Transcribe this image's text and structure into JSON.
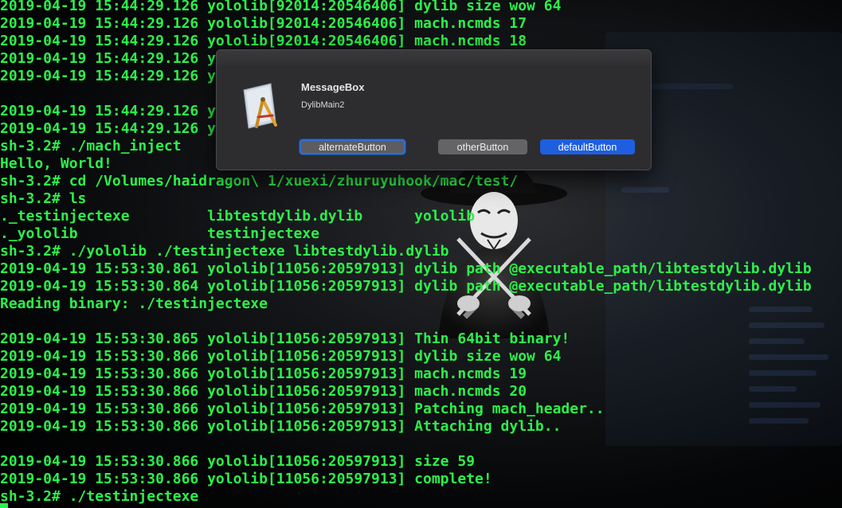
{
  "terminal": {
    "lines": [
      "2019-04-19 15:44:29.126 yololib[92014:20546406] dylib size wow 64",
      "2019-04-19 15:44:29.126 yololib[92014:20546406] mach.ncmds 17",
      "2019-04-19 15:44:29.126 yololib[92014:20546406] mach.ncmds 18",
      "2019-04-19 15:44:29.126 y",
      "2019-04-19 15:44:29.126 y",
      "",
      "2019-04-19 15:44:29.126 y",
      "2019-04-19 15:44:29.126 y",
      "sh-3.2# ./mach_inject",
      "Hello, World!",
      "sh-3.2# cd /Volumes/haidragon\\ 1/xuexi/zhuruyuhook/mac/test/",
      "sh-3.2# ls",
      "._testinjectexe         libtestdylib.dylib      yololib",
      "._yololib               testinjectexe",
      "sh-3.2# ./yololib ./testinjectexe libtestdylib.dylib",
      "2019-04-19 15:53:30.861 yololib[11056:20597913] dylib path @executable_path/libtestdylib.dylib",
      "2019-04-19 15:53:30.864 yololib[11056:20597913] dylib path @executable_path/libtestdylib.dylib",
      "Reading binary: ./testinjectexe",
      "",
      "2019-04-19 15:53:30.865 yololib[11056:20597913] Thin 64bit binary!",
      "2019-04-19 15:53:30.866 yololib[11056:20597913] dylib size wow 64",
      "2019-04-19 15:53:30.866 yololib[11056:20597913] mach.ncmds 19",
      "2019-04-19 15:53:30.866 yololib[11056:20597913] mach.ncmds 20",
      "2019-04-19 15:53:30.866 yololib[11056:20597913] Patching mach_header..",
      "2019-04-19 15:53:30.866 yololib[11056:20597913] Attaching dylib..",
      "",
      "2019-04-19 15:53:30.866 yololib[11056:20597913] size 59",
      "2019-04-19 15:53:30.866 yololib[11056:20597913] complete!",
      "sh-3.2# ./testinjectexe"
    ],
    "text_color": "#2cf04a"
  },
  "dialog": {
    "title": "MessageBox",
    "message": "DylibMain2",
    "app_icon": "app-icon",
    "buttons": {
      "alternate": "alternateButton",
      "other": "otherButton",
      "default": "defaultButton"
    },
    "accent_color": "#1e5fe0"
  }
}
